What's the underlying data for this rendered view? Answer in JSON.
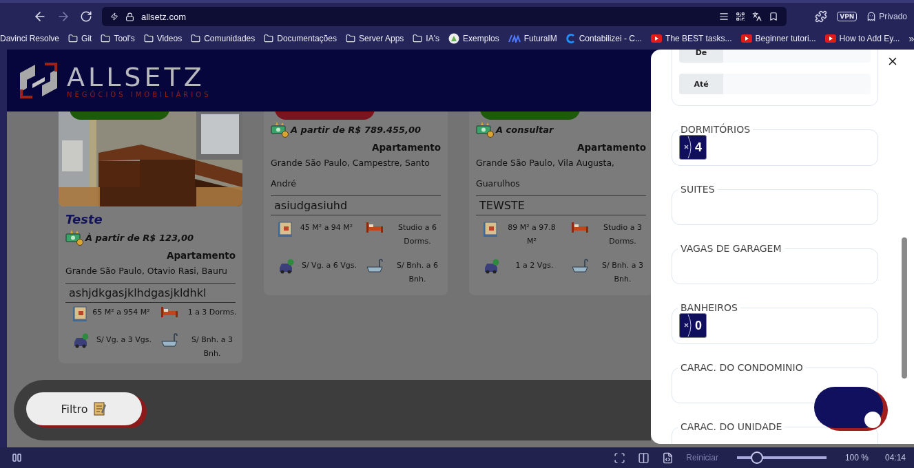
{
  "browser": {
    "url": "allsetz.com",
    "vpn_badge": "VPN",
    "profile_label": "Privado",
    "bookmarks": [
      {
        "label": "Davinci Resolve",
        "kind": "plain"
      },
      {
        "label": "Git",
        "kind": "folder"
      },
      {
        "label": "Tool's",
        "kind": "folder"
      },
      {
        "label": "Videos",
        "kind": "folder"
      },
      {
        "label": "Comunidades",
        "kind": "folder"
      },
      {
        "label": "Documentações",
        "kind": "folder"
      },
      {
        "label": "Server Apps",
        "kind": "folder"
      },
      {
        "label": "IA's",
        "kind": "folder"
      },
      {
        "label": "Exemplos",
        "kind": "site"
      },
      {
        "label": "FuturaIM",
        "kind": "brand"
      },
      {
        "label": "Contabilizei - C...",
        "kind": "ring"
      },
      {
        "label": "The BEST tasks...",
        "kind": "video"
      },
      {
        "label": "Beginner tutori...",
        "kind": "video"
      },
      {
        "label": "How to Add Ey...",
        "kind": "video"
      }
    ],
    "more_symbol": "»"
  },
  "site": {
    "logo_name": "ALLSETZ",
    "logo_tagline": "NEGÓCIOS IMOBILIÁRIOS"
  },
  "listings": [
    {
      "color": "#1d5a0c",
      "photo": true,
      "title": "Teste",
      "price": "À partir de R$ 123,00",
      "type": "Apartamento",
      "location": "Grande São Paulo, Otavio Rasi, Bauru",
      "description": "ashjdkgasjklhdgasjkldhkl",
      "features": [
        {
          "kind": "area",
          "text": "65 M² a 954 M²"
        },
        {
          "kind": "bed",
          "text": "1 a 3 Dorms."
        },
        {
          "kind": "car",
          "text": "S/ Vg. a 3 Vgs."
        },
        {
          "kind": "bath",
          "text": "S/ Bnh. a 3 Bnh."
        }
      ]
    },
    {
      "color": "#7a1420",
      "photo": false,
      "price": "A partir de R$ 789.455,00",
      "type": "Apartamento",
      "location": "Grande São Paulo, Campestre, Santo André",
      "description": "asiudgasiuhd",
      "features": [
        {
          "kind": "area",
          "text": "45 M² a 94 M²"
        },
        {
          "kind": "bed",
          "text": "Studio a 6 Dorms."
        },
        {
          "kind": "car",
          "text": "S/ Vg. a 6 Vgs."
        },
        {
          "kind": "bath",
          "text": "S/ Bnh. a 6 Bnh."
        }
      ]
    },
    {
      "color": "#1d5a0c",
      "photo": false,
      "price": "A consultar",
      "type": "Apartamento",
      "location": "Grande São Paulo, Vila Augusta, Guarulhos",
      "description": "TEWSTE",
      "features": [
        {
          "kind": "area",
          "text": "89 M² a 97.8 M²"
        },
        {
          "kind": "bed",
          "text": "Studio a 3 Dorms."
        },
        {
          "kind": "car",
          "text": "1 a 2 Vgs."
        },
        {
          "kind": "bath",
          "text": "S/ Bnh. a 3 Bnh."
        }
      ]
    }
  ],
  "filter_button": {
    "label": "Filtro"
  },
  "filter_panel": {
    "price_rows": [
      {
        "label": "De"
      },
      {
        "label": "Até"
      }
    ],
    "groups": [
      {
        "label": "DORMITÓRIOS",
        "chips": [
          "4"
        ]
      },
      {
        "label": "SUITES"
      },
      {
        "label": "VAGAS DE GARAGEM"
      },
      {
        "label": "BANHEIROS",
        "chips": [
          "0"
        ]
      },
      {
        "label": "CARAC. DO CONDOMINIO"
      },
      {
        "label": "CARAC. DO UNIDADE"
      }
    ]
  },
  "browser_footer": {
    "restart_label": "Reiniciar",
    "zoom": {
      "level": 0.22
    },
    "zoom_reading": "100 %",
    "time": "04:14"
  }
}
